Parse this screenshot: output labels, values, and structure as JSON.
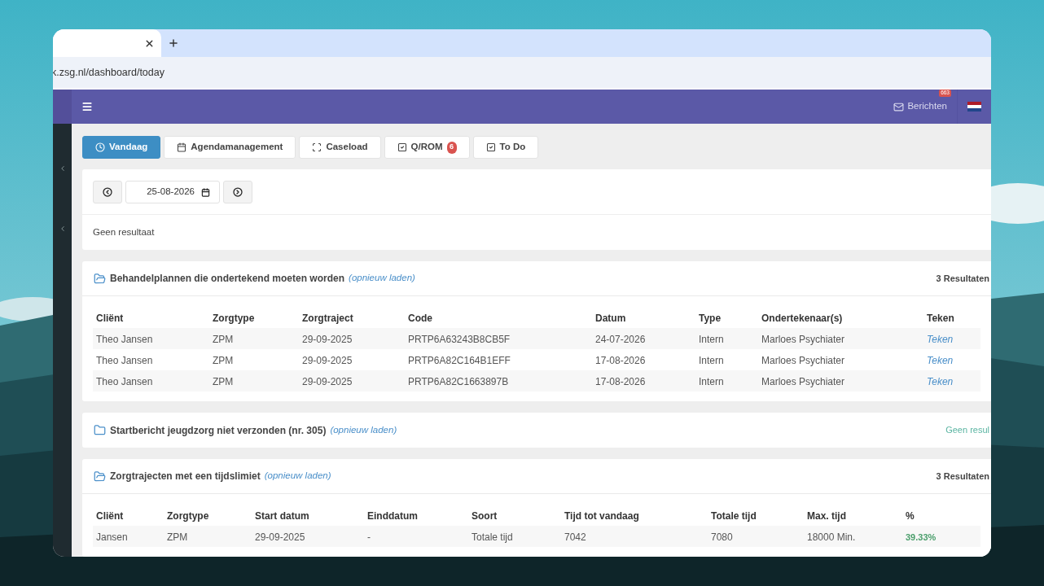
{
  "browser": {
    "url": "k.zsg.nl/dashboard/today"
  },
  "header": {
    "messages": {
      "label": "Berichten",
      "badge": "663"
    }
  },
  "nav_tabs": [
    {
      "label": "Vandaag",
      "selected": true
    },
    {
      "label": "Agendamanagement",
      "selected": false
    },
    {
      "label": "Caseload",
      "selected": false
    },
    {
      "label": "Q/ROM",
      "selected": false,
      "badge": "6"
    },
    {
      "label": "To Do",
      "selected": false
    }
  ],
  "date_picker": {
    "value": "25-08-2026"
  },
  "today": {
    "message": "Geen resultaat"
  },
  "panels": [
    {
      "title": "Behandelplannen die ondertekend moeten worden",
      "reload": "(opnieuw laden)",
      "expanded": true,
      "empty": false,
      "count": "3 Resultaten",
      "table": {
        "columns": [
          {
            "label": "Cliënt",
            "kind": "text"
          },
          {
            "label": "Zorgtype",
            "kind": "text"
          },
          {
            "label": "Zorgtraject",
            "kind": "text"
          },
          {
            "label": "Code",
            "kind": "text"
          },
          {
            "label": "Datum",
            "kind": "text"
          },
          {
            "label": "Type",
            "kind": "text"
          },
          {
            "label": "Ondertekenaar(s)",
            "kind": "text"
          },
          {
            "label": "Teken",
            "kind": "link"
          }
        ],
        "rows": [
          [
            "Theo Jansen",
            "ZPM",
            "29-09-2025",
            "PRTP6A63243B8CB5F",
            "24-07-2026",
            "Intern",
            "Marloes Psychiater",
            "Teken"
          ],
          [
            "Theo Jansen",
            "ZPM",
            "29-09-2025",
            "PRTP6A82C164B1EFF",
            "17-08-2026",
            "Intern",
            "Marloes Psychiater",
            "Teken"
          ],
          [
            "Theo Jansen",
            "ZPM",
            "29-09-2025",
            "PRTP6A82C1663897B",
            "17-08-2026",
            "Intern",
            "Marloes Psychiater",
            "Teken"
          ]
        ]
      }
    },
    {
      "title": "Startbericht jeugdzorg niet verzonden (nr. 305)",
      "reload": "(opnieuw laden)",
      "expanded": false,
      "empty": true,
      "count": "Geen resul"
    },
    {
      "title": "Zorgtrajecten met een tijdslimiet",
      "reload": "(opnieuw laden)",
      "expanded": true,
      "empty": false,
      "count": "3 Resultaten",
      "table": {
        "columns": [
          {
            "label": "Cliënt",
            "kind": "text"
          },
          {
            "label": "Zorgtype",
            "kind": "text"
          },
          {
            "label": "Start datum",
            "kind": "text"
          },
          {
            "label": "Einddatum",
            "kind": "text"
          },
          {
            "label": "Soort",
            "kind": "text"
          },
          {
            "label": "Tijd tot vandaag",
            "kind": "text"
          },
          {
            "label": "Totale tijd",
            "kind": "text"
          },
          {
            "label": "Max. tijd",
            "kind": "text"
          },
          {
            "label": "%",
            "kind": "percent"
          }
        ],
        "rows": [
          [
            "Jansen",
            "ZPM",
            "29-09-2025",
            "-",
            "Totale tijd",
            "7042",
            "7080",
            "18000 Min.",
            "39.33%"
          ]
        ]
      }
    }
  ]
}
